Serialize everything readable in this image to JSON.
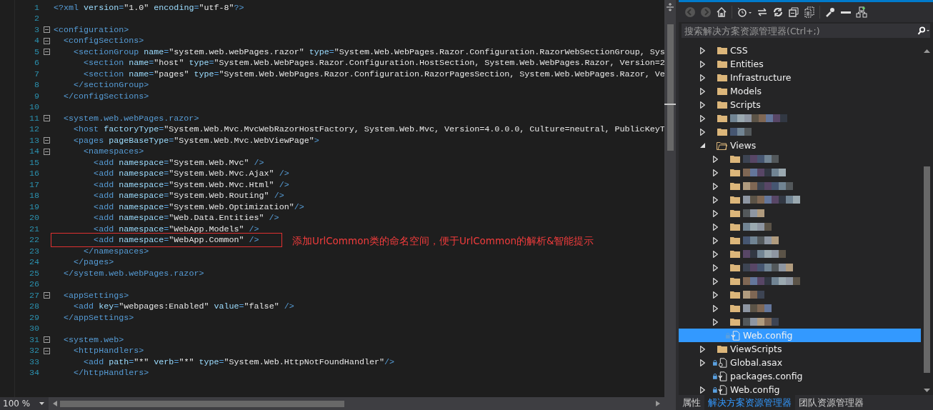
{
  "editor": {
    "lines": [
      {
        "number": "1",
        "text": "<?xml version=\"1.0\" encoding=\"utf-8\"?>",
        "collapsible": false
      },
      {
        "number": "2",
        "collapsible": false
      },
      {
        "number": "3",
        "text": "<configuration>",
        "collapsible": true
      },
      {
        "number": "4",
        "text": "  <configSections>",
        "collapsible": true
      },
      {
        "number": "5",
        "text": "    <sectionGroup name=\"system.web.webPages.razor\" type=\"System.Web.WebPages.Razor.Configuration.RazorWebSectionGroup, Sys",
        "collapsible": true
      },
      {
        "number": "6",
        "text": "      <section name=\"host\" type=\"System.Web.WebPages.Razor.Configuration.HostSection, System.Web.WebPages.Razor, Version=2",
        "collapsible": false
      },
      {
        "number": "7",
        "text": "      <section name=\"pages\" type=\"System.Web.WebPages.Razor.Configuration.RazorPagesSection, System.Web.WebPages.Razor, Ve",
        "collapsible": false
      },
      {
        "number": "8",
        "text": "    </sectionGroup>",
        "collapsible": false
      },
      {
        "number": "9",
        "text": "  </configSections>",
        "collapsible": false
      },
      {
        "number": "10",
        "collapsible": false
      },
      {
        "number": "11",
        "text": "  <system.web.webPages.razor>",
        "collapsible": true
      },
      {
        "number": "12",
        "text": "    <host factoryType=\"System.Web.Mvc.MvcWebRazorHostFactory, System.Web.Mvc, Version=4.0.0.0, Culture=neutral, PublicKeyT",
        "collapsible": false
      },
      {
        "number": "13",
        "text": "    <pages pageBaseType=\"System.Web.Mvc.WebViewPage\">",
        "collapsible": true
      },
      {
        "number": "14",
        "text": "      <namespaces>",
        "collapsible": true
      },
      {
        "number": "15",
        "text": "        <add namespace=\"System.Web.Mvc\" />",
        "collapsible": false
      },
      {
        "number": "16",
        "text": "        <add namespace=\"System.Web.Mvc.Ajax\" />",
        "collapsible": false
      },
      {
        "number": "17",
        "text": "        <add namespace=\"System.Web.Mvc.Html\" />",
        "collapsible": false
      },
      {
        "number": "18",
        "text": "        <add namespace=\"System.Web.Routing\" />",
        "collapsible": false
      },
      {
        "number": "19",
        "text": "        <add namespace=\"System.Web.Optimization\"/>",
        "collapsible": false
      },
      {
        "number": "20",
        "text": "        <add namespace=\"Web.Data.Entities\" />",
        "collapsible": false
      },
      {
        "number": "21",
        "text": "        <add namespace=\"WebApp.Models\" />",
        "collapsible": false
      },
      {
        "number": "22",
        "text": "        <add namespace=\"WebApp.Common\" />",
        "collapsible": false,
        "annotation": "添加UrlCommon类的命名空间，便于UrlCommon的解析&智能提示"
      },
      {
        "number": "23",
        "text": "      </namespaces>",
        "collapsible": false
      },
      {
        "number": "24",
        "text": "    </pages>",
        "collapsible": false
      },
      {
        "number": "25",
        "text": "  </system.web.webPages.razor>",
        "collapsible": false
      },
      {
        "number": "26",
        "collapsible": false
      },
      {
        "number": "27",
        "text": "  <appSettings>",
        "collapsible": true
      },
      {
        "number": "28",
        "text": "    <add key=\"webpages:Enabled\" value=\"false\" />",
        "collapsible": false
      },
      {
        "number": "29",
        "text": "  </appSettings>",
        "collapsible": false
      },
      {
        "number": "30",
        "collapsible": false
      },
      {
        "number": "31",
        "text": "  <system.web>",
        "collapsible": true
      },
      {
        "number": "32",
        "text": "    <httpHandlers>",
        "collapsible": true
      },
      {
        "number": "33",
        "text": "      <add path=\"*\" verb=\"*\" type=\"System.Web.HttpNotFoundHandler\"/>",
        "collapsible": false
      },
      {
        "number": "34",
        "text": "    </httpHandlers>",
        "collapsible": false
      }
    ],
    "zoom": "100 %"
  },
  "solution_explorer": {
    "search": {
      "placeholder": "搜索解决方案资源管理器(Ctrl+;)"
    },
    "tree": [
      {
        "kind": "folder",
        "label": "CSS",
        "expanded": false,
        "selected": false,
        "locked": false
      },
      {
        "kind": "folder",
        "label": "Entities",
        "expanded": false,
        "selected": false,
        "locked": false
      },
      {
        "kind": "folder",
        "label": "Infrastructure",
        "expanded": false,
        "selected": false,
        "locked": false
      },
      {
        "kind": "folder",
        "label": "Models",
        "expanded": false,
        "selected": false,
        "locked": false
      },
      {
        "kind": "folder",
        "label": "Scripts",
        "expanded": false,
        "selected": false,
        "locked": false
      },
      {
        "kind": "blurred-folder",
        "expanded": false,
        "selected": false,
        "locked": false
      },
      {
        "kind": "blurred-folder",
        "expanded": false,
        "selected": false,
        "locked": false
      },
      {
        "kind": "folder",
        "label": "Views",
        "expanded": true,
        "selected": false,
        "locked": false,
        "children": [
          {
            "kind": "blurred-folder",
            "expanded": false,
            "selected": false,
            "locked": false
          },
          {
            "kind": "blurred-folder",
            "expanded": false,
            "selected": false,
            "locked": false
          },
          {
            "kind": "blurred-folder",
            "expanded": false,
            "selected": false,
            "locked": false
          },
          {
            "kind": "blurred-folder",
            "expanded": false,
            "selected": false,
            "locked": false
          },
          {
            "kind": "blurred-folder",
            "expanded": false,
            "selected": false,
            "locked": false
          },
          {
            "kind": "blurred-folder",
            "expanded": false,
            "selected": false,
            "locked": false
          },
          {
            "kind": "blurred-folder",
            "expanded": false,
            "selected": false,
            "locked": false
          },
          {
            "kind": "blurred-folder",
            "expanded": false,
            "selected": false,
            "locked": false
          },
          {
            "kind": "blurred-folder",
            "expanded": false,
            "selected": false,
            "locked": false
          },
          {
            "kind": "blurred-folder",
            "expanded": false,
            "selected": false,
            "locked": false
          },
          {
            "kind": "blurred-folder",
            "expanded": false,
            "selected": false,
            "locked": false
          },
          {
            "kind": "blurred-folder",
            "expanded": false,
            "selected": false,
            "locked": false
          },
          {
            "kind": "blurred-folder",
            "expanded": false,
            "selected": false,
            "locked": false
          },
          {
            "kind": "config-file",
            "label": "Web.config",
            "selected": true,
            "locked": true
          }
        ]
      },
      {
        "kind": "folder",
        "label": "ViewScripts",
        "expanded": false,
        "selected": false,
        "locked": false
      },
      {
        "kind": "asax-file",
        "label": "Global.asax",
        "expanded": false,
        "selected": false,
        "locked": true
      },
      {
        "kind": "config-file",
        "label": "packages.config",
        "selected": false,
        "locked": true
      },
      {
        "kind": "config-file",
        "label": "Web.config",
        "expanded": false,
        "selected": false,
        "locked": true
      }
    ],
    "tabs": [
      {
        "label": "属性",
        "selected": false
      },
      {
        "label": "解决方案资源管理器",
        "selected": true
      },
      {
        "label": "团队资源管理器",
        "selected": false
      }
    ]
  }
}
